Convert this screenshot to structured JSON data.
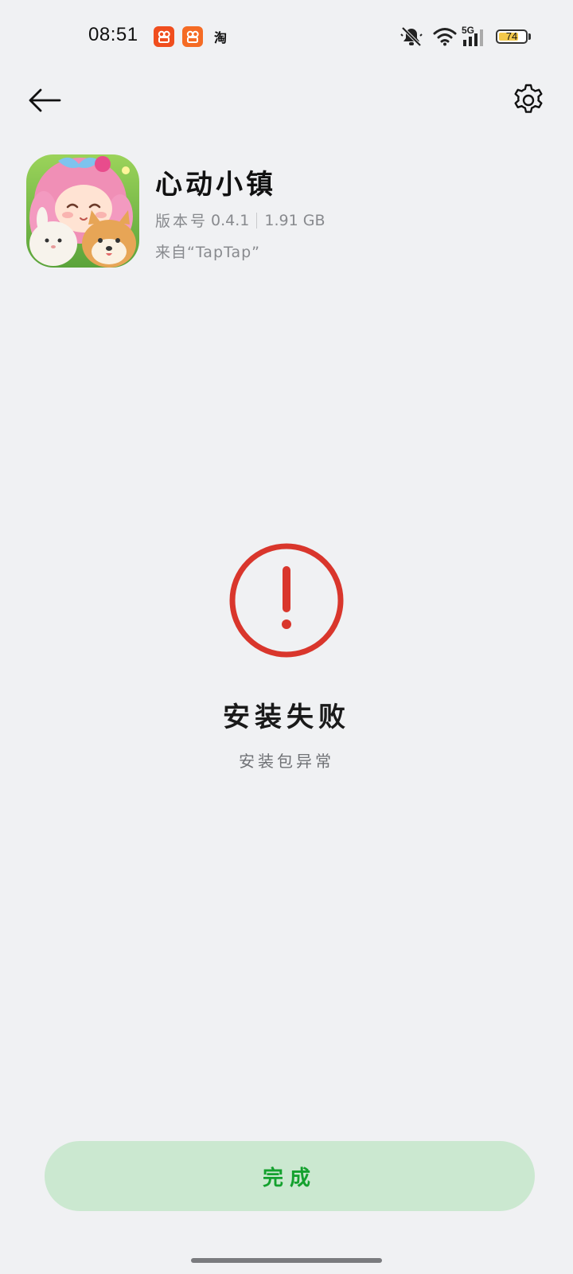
{
  "status_bar": {
    "time": "08:51",
    "notifications": [
      {
        "icon": "kuaishou-icon",
        "glyph": "◉"
      },
      {
        "icon": "kuaishou-lite-icon",
        "glyph": "◉"
      },
      {
        "icon": "taobao-icon",
        "glyph": "淘"
      }
    ],
    "network": "5G",
    "battery_level": "74",
    "battery_fraction": 0.74,
    "icons": [
      "mute-icon",
      "wifi-icon",
      "signal-icon",
      "battery-icon"
    ]
  },
  "nav": {
    "back_icon": "arrow-left-icon",
    "settings_icon": "gear-icon"
  },
  "app": {
    "name": "心动小镇",
    "version_label": "版本号",
    "version": "0.4.1",
    "size": "1.91 GB",
    "source": "来自“TapTap”"
  },
  "result": {
    "icon": "error-circle-icon",
    "title": "安装失败",
    "description": "安装包异常",
    "accent_color": "#d9362c"
  },
  "actions": {
    "done_label": "完成",
    "done_bg": "#cbe8d0",
    "done_text_color": "#14a12e"
  }
}
